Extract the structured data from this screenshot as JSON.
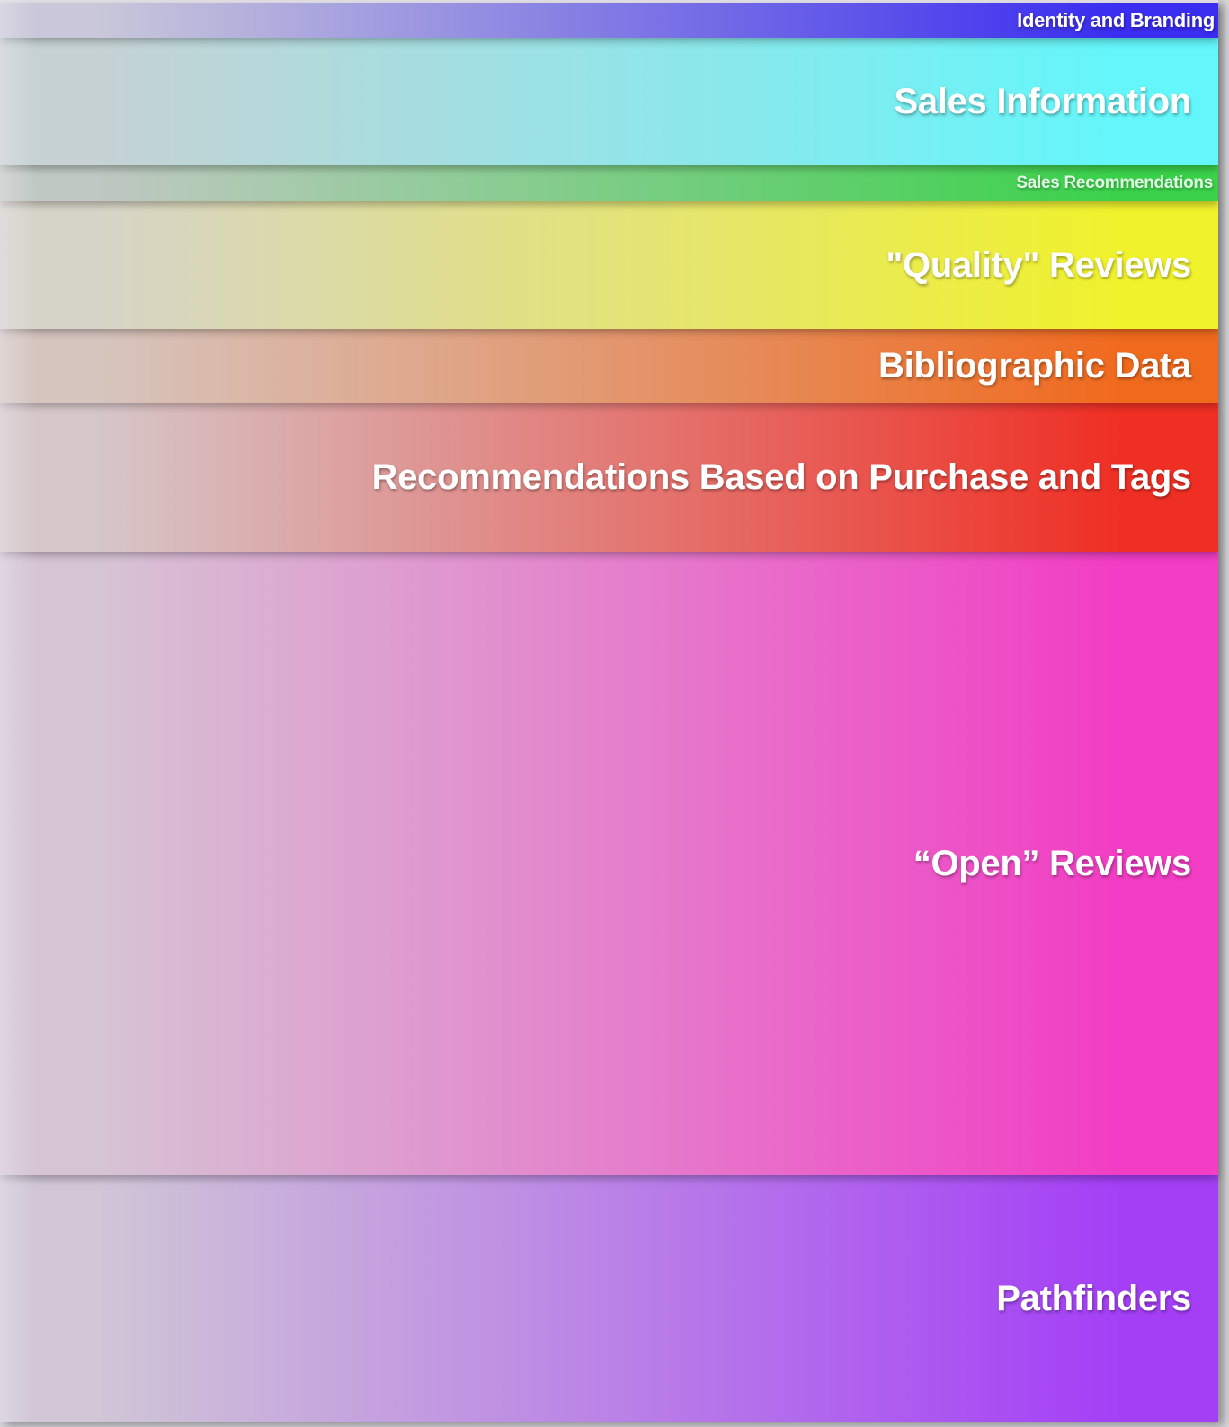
{
  "bands": [
    {
      "label": "Identity and Branding",
      "color": "#3a2df0",
      "fade": "#c9c7d9"
    },
    {
      "label": "Sales Information",
      "color": "#63f6fa",
      "fade": "#c6d2d4"
    },
    {
      "label": "Sales Recommendations",
      "color": "#3ad24a",
      "fade": "#bfc8c2"
    },
    {
      "label": "\"Quality\" Reviews",
      "color": "#f0f22c",
      "fade": "#d6d4c8"
    },
    {
      "label": "Bibliographic Data",
      "color": "#f06a1e",
      "fade": "#d6c4be"
    },
    {
      "label": "Recommendations Based on Purchase and Tags",
      "color": "#ef2f24",
      "fade": "#d6c6c8"
    },
    {
      "label": "“Open” Reviews",
      "color": "#f23dc4",
      "fade": "#d6c4d4"
    },
    {
      "label": "Pathfinders",
      "color": "#a43ff6",
      "fade": "#d0c6d6"
    }
  ]
}
